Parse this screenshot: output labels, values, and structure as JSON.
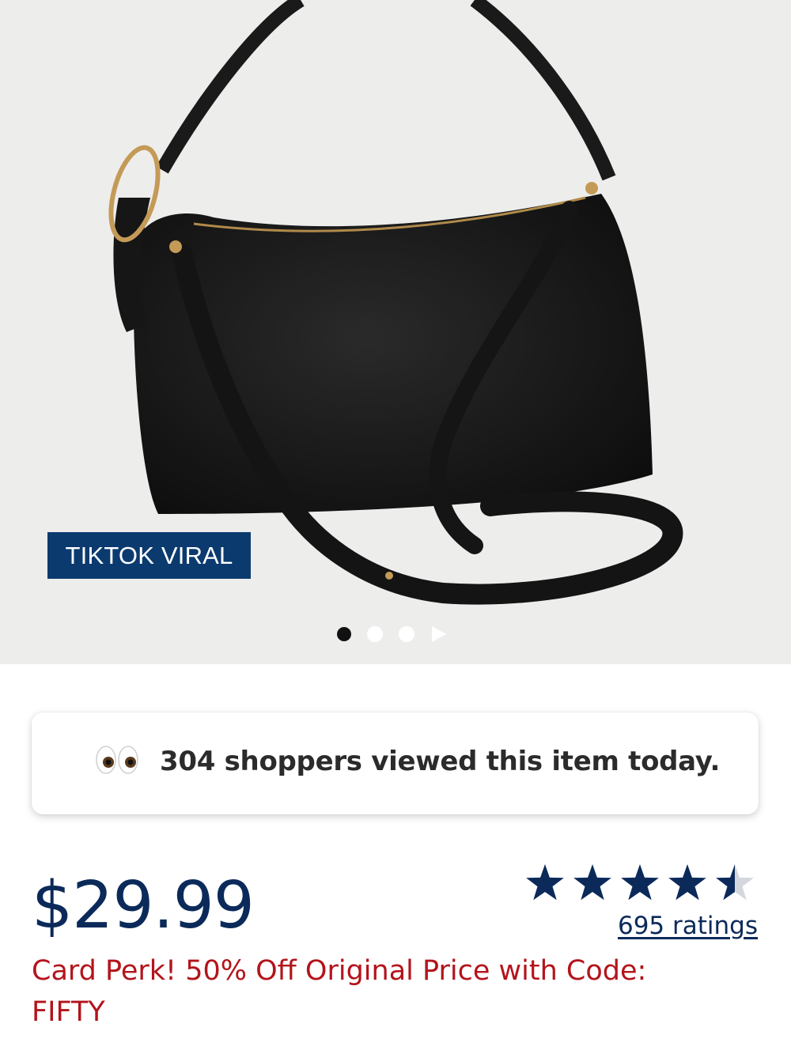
{
  "product": {
    "badge": "TIKTOK VIRAL",
    "image_alt": "Black faux-leather shoulder bag with crossbody strap",
    "carousel": {
      "total_dots": 3,
      "active_index": 0
    }
  },
  "social_proof": {
    "icon": "eyes-emoji-icon",
    "text": "304 shoppers viewed this item today."
  },
  "pricing": {
    "price": "$29.99",
    "promo": "Card Perk! 50% Off Original Price with Code: FIFTY"
  },
  "rating": {
    "stars": 4.5,
    "max_stars": 5,
    "ratings_label": "695 ratings"
  },
  "colors": {
    "badge_bg": "#0b3a6f",
    "price": "#0b2a5a",
    "promo": "#b3141b",
    "star": "#0b2a5a"
  }
}
